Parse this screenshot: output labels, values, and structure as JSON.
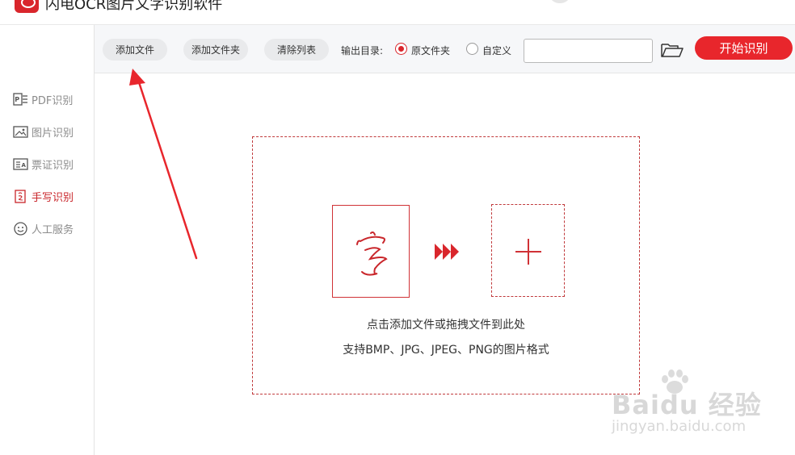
{
  "app": {
    "title": "闪电OCR图片文字识别软件"
  },
  "sidebar": {
    "items": [
      {
        "label": "PDF识别",
        "icon": "pdf-icon",
        "active": false
      },
      {
        "label": "图片识别",
        "icon": "image-icon",
        "active": false
      },
      {
        "label": "票证识别",
        "icon": "id-card-icon",
        "active": false
      },
      {
        "label": "手写识别",
        "icon": "handwriting-icon",
        "active": true
      },
      {
        "label": "人工服务",
        "icon": "smiley-icon",
        "active": false
      }
    ]
  },
  "toolbar": {
    "add_file_label": "添加文件",
    "add_folder_label": "添加文件夹",
    "clear_list_label": "清除列表",
    "output_dir_label": "输出目录:",
    "radio_original_label": "原文件夹",
    "radio_custom_label": "自定义",
    "selected_output": "原文件夹",
    "path_value": "",
    "start_label": "开始识别"
  },
  "dropzone": {
    "sample_char": "字",
    "hint_line1": "点击添加文件或拖拽文件到此处",
    "hint_line2": "支持BMP、JPG、JPEG、PNG的图片格式"
  },
  "watermark": {
    "logo_text": "Baidu 经验",
    "url_text": "jingyan.baidu.com"
  },
  "colors": {
    "accent": "#e8262c",
    "active_nav": "#c9262b",
    "sidebar_text": "#8c8c8c",
    "toolbar_bg": "#f6f7f9",
    "button_bg": "#e9eaec"
  }
}
